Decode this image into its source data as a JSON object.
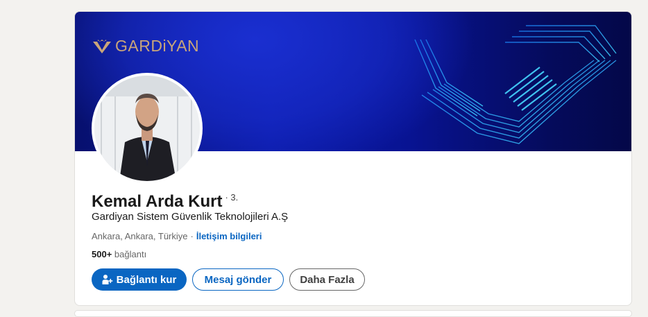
{
  "banner": {
    "logo_text": "GARDiYAN",
    "background_color": "#0b1aa8",
    "accent_color": "#c9a57a"
  },
  "profile": {
    "name": "Kemal Arda Kurt",
    "degree": "· 3.",
    "headline": "Gardiyan Sistem Güvenlik Teknolojileri A.Ş",
    "location": "Ankara, Ankara, Türkiye",
    "location_separator": "·",
    "contact_link": "İletişim bilgileri",
    "connections_count": "500+",
    "connections_label": "bağlantı"
  },
  "actions": {
    "connect_label": "Bağlantı kur",
    "message_label": "Mesaj gönder",
    "more_label": "Daha Fazla",
    "primary_color": "#0a66c2"
  },
  "icons": {
    "connect_icon": "person-add-icon",
    "logo_icon": "gardiyan-shield-icon"
  }
}
